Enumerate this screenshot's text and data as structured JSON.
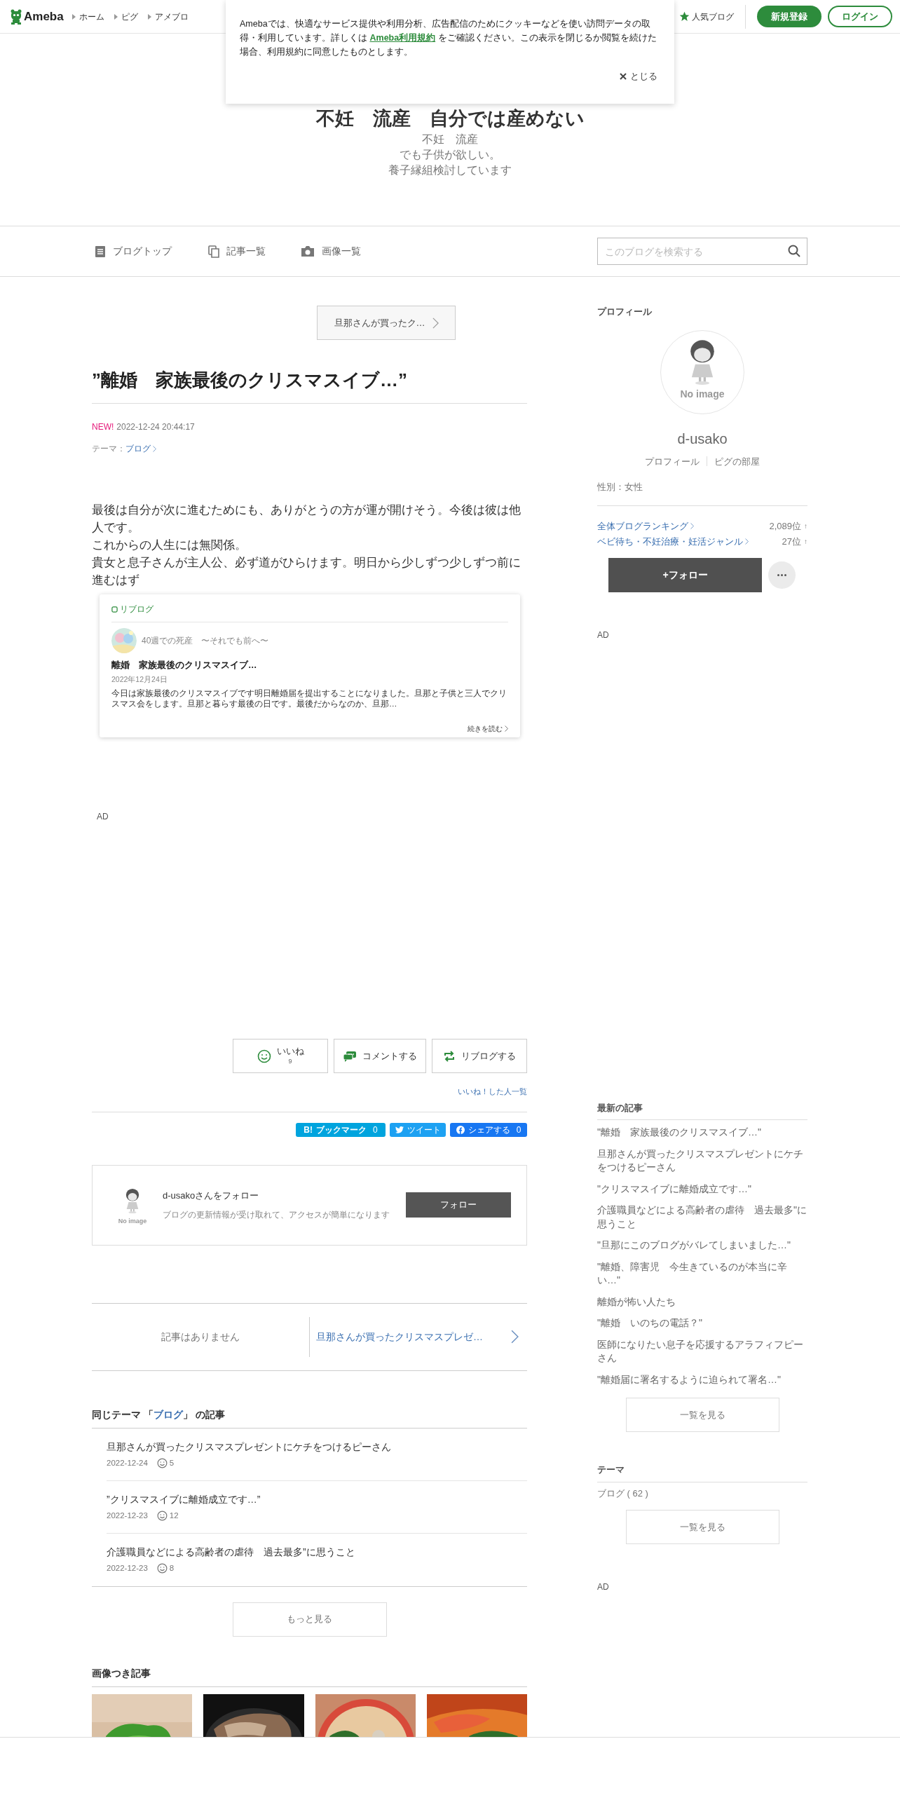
{
  "header": {
    "logo": "Ameba",
    "nav": [
      "ホーム",
      "ピグ",
      "アメブロ"
    ],
    "popular": "人気ブログ",
    "signup": "新規登録",
    "login": "ログイン"
  },
  "cookie_notice": {
    "text_before": "Amebaでは、快適なサービス提供や利用分析、広告配信のためにクッキーなどを使い訪問データの取得・利用しています。詳しくは ",
    "link": "Ameba利用規約",
    "text_after": " をご確認ください。この表示を閉じるか閲覧を続けた場合、利用規約に同意したものとします。",
    "close": "とじる"
  },
  "blog": {
    "title": "不妊　流産　自分では産めない",
    "description": [
      "不妊　流産",
      "でも子供が欲しい。",
      "養子縁組検討しています"
    ]
  },
  "blog_nav": {
    "items": [
      {
        "kind": "top",
        "label": "ブログトップ"
      },
      {
        "kind": "list",
        "label": "記事一覧"
      },
      {
        "kind": "images",
        "label": "画像一覧"
      }
    ],
    "search": {
      "placeholder": "このブログを検索する"
    }
  },
  "article": {
    "prev_link": "旦那さんが買ったク…",
    "title": "”離婚　家族最後のクリスマスイブ…”",
    "new_badge": "NEW!",
    "date": "2022-12-24 20:44:17",
    "theme_label": "テーマ：",
    "theme": "ブログ",
    "body": [
      "最後は自分が次に進むためにも、ありがとうの方が運が開けそう。今後は彼は他人です。",
      "これからの人生には無関係。",
      "貴女と息子さんが主人公、必ず道がひらけます。明日から少しずつ少しずつ前に進むはず"
    ],
    "reblog": {
      "label": "リブログ",
      "blog_name": "40週での死産　〜それでも前へ〜",
      "title": "離婚　家族最後のクリスマスイブ…",
      "date": "2022年12月24日",
      "excerpt": "今日は家族最後のクリスマスイブです明日離婚届を提出することになりました。旦那と子供と三人でクリスマス会をします。旦那と暮らす最後の日です。最後だからなのか、旦那…",
      "read_more": "続きを読む"
    },
    "ad": "AD",
    "actions": [
      {
        "kind": "like",
        "label": "いいね",
        "count": "9"
      },
      {
        "kind": "comment",
        "label": "コメントする"
      },
      {
        "kind": "reblog",
        "label": "リブログする"
      }
    ],
    "likers_link": "いいね！した人一覧",
    "share": [
      {
        "kind": "hatena",
        "mark": "B!",
        "label": "ブックマーク",
        "count": "0"
      },
      {
        "kind": "twitter",
        "label": "ツイート"
      },
      {
        "kind": "facebook",
        "label": "シェアする",
        "count": "0"
      }
    ]
  },
  "follow_box": {
    "avatar_text": "No image",
    "title": "d-usakoさんをフォロー",
    "description": "ブログの更新情報が受け取れて、アクセスが簡単になります",
    "button": "フォロー"
  },
  "pager": {
    "prev": "記事はありません",
    "next": "旦那さんが買ったクリスマスプレゼ…"
  },
  "same_theme": {
    "before": "同じテーマ 「",
    "theme": "ブログ",
    "after": "」 の記事",
    "items": [
      {
        "title": "旦那さんが買ったクリスマスプレゼントにケチをつけるピーさん",
        "date": "2022-12-24",
        "likes": "5"
      },
      {
        "title": "”クリスマスイブに離婚成立です…”",
        "date": "2022-12-23",
        "likes": "12"
      },
      {
        "title": "介護職員などによる高齢者の虐待　過去最多”に思うこと",
        "date": "2022-12-23",
        "likes": "8"
      }
    ],
    "more": "もっと見る"
  },
  "image_articles": {
    "heading": "画像つき記事"
  },
  "sidebar": {
    "profile": {
      "heading": "プロフィール",
      "avatar_text": "No image",
      "name": "d-usako",
      "links": [
        "プロフィール",
        "ピグの部屋"
      ],
      "gender": "性別：女性",
      "rankings": [
        {
          "label": "全体ブログランキング",
          "rank": "2,089位",
          "trend": "↑"
        },
        {
          "label": "ベビ待ち・不妊治療・妊活ジャンル",
          "rank": "27位",
          "trend": "↑"
        }
      ],
      "follow": "+フォロー"
    },
    "ad": "AD",
    "latest": {
      "heading": "最新の記事",
      "items": [
        "\"離婚　家族最後のクリスマスイブ…\"",
        "旦那さんが買ったクリスマスプレゼントにケチをつけるピーさん",
        "\"クリスマスイブに離婚成立です…\"",
        "介護職員などによる高齢者の虐待　過去最多\"に思うこと",
        "\"旦那にこのブログがバレてしまいました…\"",
        "\"離婚、障害児　今生きているのが本当に辛い…\"",
        "離婚が怖い人たち",
        "\"離婚　いのちの電話？\"",
        "医師になりたい息子を応援するアラフィフピーさん",
        "\"離婚届に署名するように迫られて署名…\""
      ],
      "button": "一覧を見る"
    },
    "themes": {
      "heading": "テーマ",
      "items": [
        "ブログ ( 62 )"
      ],
      "button": "一覧を見る"
    },
    "ad2": "AD"
  }
}
